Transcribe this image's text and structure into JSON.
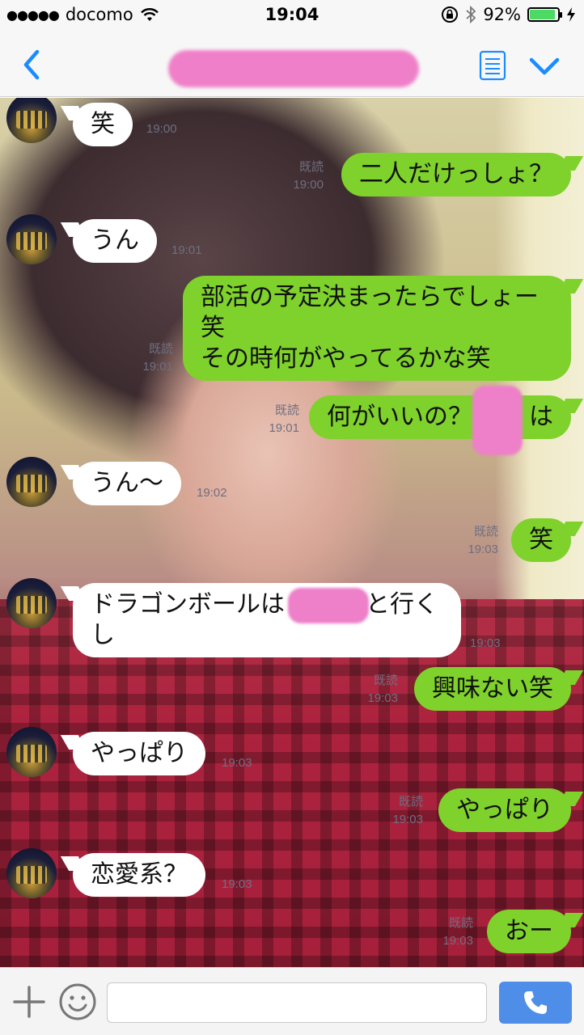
{
  "status_bar": {
    "signal_dots": "●●●●●",
    "carrier": "docomo",
    "time": "19:04",
    "battery_percent": "92%",
    "battery_level": 0.92,
    "icons": [
      "wifi-icon",
      "rotation-lock-icon",
      "bluetooth-icon",
      "battery-icon",
      "charging-icon"
    ]
  },
  "header": {
    "icons": [
      "back-arrow-icon",
      "menu-list-icon",
      "chevron-down-icon"
    ]
  },
  "messages": [
    {
      "side": "left",
      "text": "笑",
      "time": "19:00"
    },
    {
      "side": "right",
      "text": "二人だけっしょ？",
      "read": "既読",
      "time": "19:00"
    },
    {
      "side": "left",
      "text": "うん",
      "time": "19:01"
    },
    {
      "side": "right",
      "text": "部活の予定決まったらでしょー笑\nその時何がやってるかな笑",
      "read": "既読",
      "time": "19:01"
    },
    {
      "side": "right",
      "text_before": "何がいいの？",
      "text_after": "は",
      "read": "既読",
      "time": "19:01"
    },
    {
      "side": "left",
      "text": "うん〜",
      "time": "19:02"
    },
    {
      "side": "right",
      "text": "笑",
      "read": "既読",
      "time": "19:03"
    },
    {
      "side": "left",
      "text_before": "ドラゴンボールは",
      "text_after": "と行くし",
      "time": "19:03"
    },
    {
      "side": "right",
      "text": "興味ない笑",
      "read": "既読",
      "time": "19:03"
    },
    {
      "side": "left",
      "text": "やっぱり",
      "time": "19:03"
    },
    {
      "side": "right",
      "text": "やっぱり",
      "read": "既読",
      "time": "19:03"
    },
    {
      "side": "left",
      "text": "恋愛系？",
      "time": "19:03"
    },
    {
      "side": "right",
      "text": "おー",
      "read": "既読",
      "time": "19:03"
    }
  ],
  "input_bar": {
    "placeholder": "",
    "icons": [
      "plus-icon",
      "smiley-icon",
      "phone-icon"
    ]
  },
  "colors": {
    "accent_blue": "#1a8cff",
    "bubble_green": "#7fd12c",
    "send_button": "#4f8ee8"
  }
}
